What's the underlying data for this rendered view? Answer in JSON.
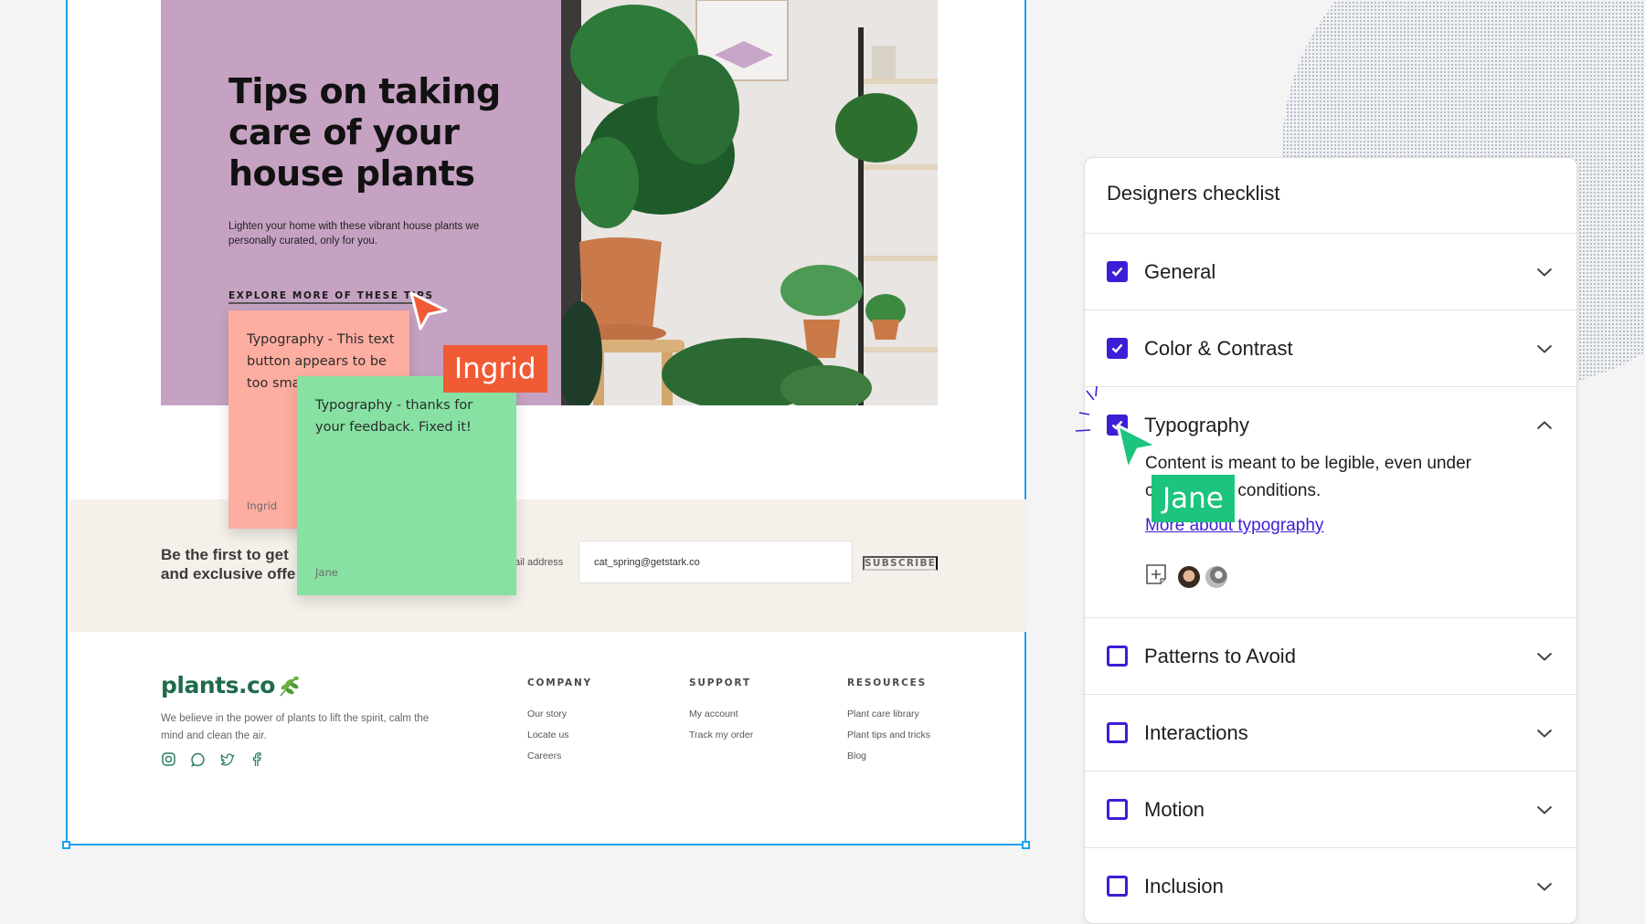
{
  "hero": {
    "title": "Tips on taking care of your house plants",
    "subtitle": "Lighten your home with these vibrant house plants we personally curated, only for you.",
    "link": "EXPLORE MORE OF THESE TIPS",
    "background_color": "#c6a2c2"
  },
  "newsletter": {
    "text_line1": "Be the first to get",
    "text_line2": "and exclusive offe",
    "email_label": "ail address",
    "email_value": "cat_spring@getstark.co",
    "subscribe_label": "SUBSCRIBE"
  },
  "footer": {
    "logo": "plants.co",
    "tagline": "We believe in the power of plants to lift the spirit, calm the mind and clean the air.",
    "socials": [
      "instagram-icon",
      "whatsapp-icon",
      "twitter-icon",
      "facebook-icon"
    ],
    "columns": [
      {
        "heading": "COMPANY",
        "links": [
          "Our story",
          "Locate us",
          "Careers"
        ]
      },
      {
        "heading": "SUPPORT",
        "links": [
          "My account",
          "Track my order"
        ]
      },
      {
        "heading": "RESOURCES",
        "links": [
          "Plant care library",
          "Plant tips and tricks",
          "Blog"
        ]
      }
    ]
  },
  "comments": [
    {
      "text": "Typography - This text button appears to be too small.",
      "author": "Ingrid",
      "color": "#fdaea1"
    },
    {
      "text": "Typography - thanks for your feedback. Fixed it!",
      "author": "Jane",
      "color": "#87e1a3"
    }
  ],
  "cursors": [
    {
      "name": "Ingrid",
      "color": "#f05a35"
    },
    {
      "name": "Jane",
      "color": "#1dc47d"
    }
  ],
  "checklist": {
    "title": "Designers checklist",
    "accent": "#3a1fd6",
    "items": [
      {
        "label": "General",
        "checked": true,
        "expanded": false
      },
      {
        "label": "Color & Contrast",
        "checked": true,
        "expanded": false
      },
      {
        "label": "Typography",
        "checked": true,
        "expanded": true,
        "description": "Content is meant to be legible, even under challenging conditions.",
        "link": "More about typography"
      },
      {
        "label": "Patterns to Avoid",
        "checked": false,
        "expanded": false
      },
      {
        "label": "Interactions",
        "checked": false,
        "expanded": false
      },
      {
        "label": "Motion",
        "checked": false,
        "expanded": false
      },
      {
        "label": "Inclusion",
        "checked": false,
        "expanded": false
      }
    ]
  }
}
